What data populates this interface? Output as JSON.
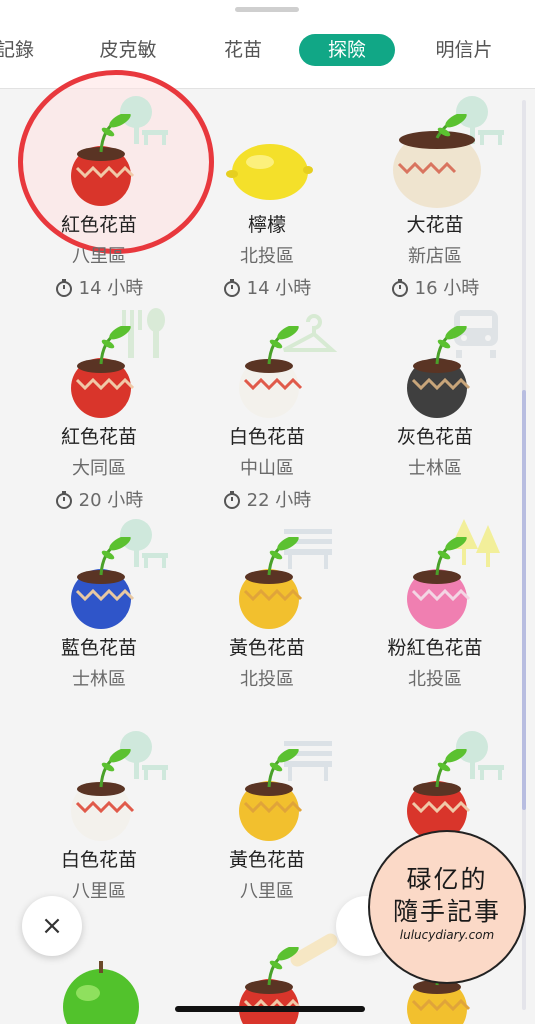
{
  "tabs": [
    {
      "label": "記錄",
      "active": false
    },
    {
      "label": "皮克敏",
      "active": false
    },
    {
      "label": "花苗",
      "active": false
    },
    {
      "label": "探險",
      "active": true
    },
    {
      "label": "明信片",
      "active": false
    }
  ],
  "colors": {
    "accent": "#11a786",
    "highlight": "#e8383d"
  },
  "items": [
    {
      "name": "紅色花苗",
      "district": "八里區",
      "time": "14 小時",
      "pot": "red",
      "bg_icon": "tree-bench-icon",
      "highlighted": true
    },
    {
      "name": "檸檬",
      "district": "北投區",
      "time": "14 小時",
      "pot": "lemon",
      "bg_icon": "none"
    },
    {
      "name": "大花苗",
      "district": "新店區",
      "time": "16 小時",
      "pot": "big",
      "bg_icon": "tree-bench-icon"
    },
    {
      "name": "紅色花苗",
      "district": "大同區",
      "time": "20 小時",
      "pot": "red",
      "bg_icon": "fork-spoon-icon"
    },
    {
      "name": "白色花苗",
      "district": "中山區",
      "time": "22 小時",
      "pot": "white",
      "bg_icon": "hanger-icon"
    },
    {
      "name": "灰色花苗",
      "district": "士林區",
      "time": "",
      "pot": "gray",
      "bg_icon": "train-icon"
    },
    {
      "name": "藍色花苗",
      "district": "士林區",
      "time": "",
      "pot": "blue",
      "bg_icon": "tree-bench-icon"
    },
    {
      "name": "黃色花苗",
      "district": "北投區",
      "time": "",
      "pot": "yellow",
      "bg_icon": "bench-icon"
    },
    {
      "name": "粉紅色花苗",
      "district": "北投區",
      "time": "",
      "pot": "pink",
      "bg_icon": "pine-trees-icon"
    },
    {
      "name": "白色花苗",
      "district": "八里區",
      "time": "",
      "pot": "white",
      "bg_icon": "tree-bench-icon"
    },
    {
      "name": "黃色花苗",
      "district": "八里區",
      "time": "",
      "pot": "yellow",
      "bg_icon": "bench-icon"
    },
    {
      "name": "",
      "district": "",
      "time": "",
      "pot": "red",
      "bg_icon": "tree-bench-icon"
    }
  ],
  "partial_row": [
    {
      "pot": "green-apple"
    },
    {
      "pot": "red",
      "bg_icon": "baguette-icon"
    },
    {
      "pot": "yellow"
    }
  ],
  "close_label": "×",
  "watermark": {
    "line1": "碌亿的",
    "line2": "隨手記事",
    "url": "lulucydiary.com"
  }
}
